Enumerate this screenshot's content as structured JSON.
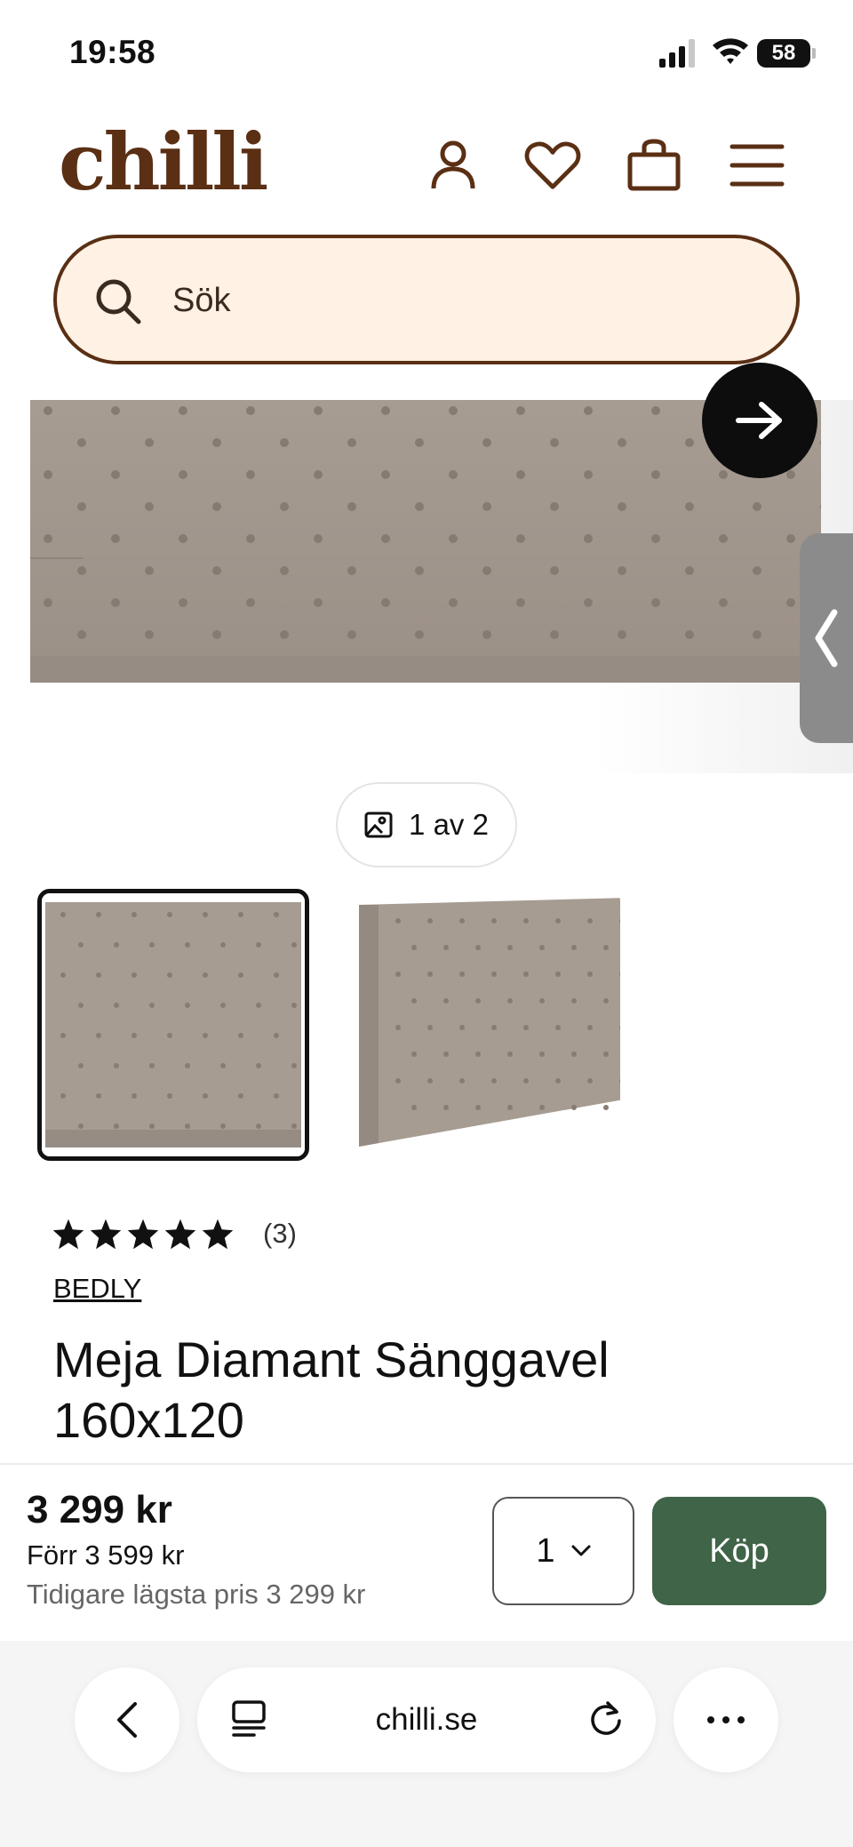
{
  "status_bar": {
    "time": "19:58",
    "battery": "58",
    "signal_bars": 3,
    "icons": [
      "signal-icon",
      "wifi-icon",
      "battery-icon"
    ]
  },
  "header": {
    "logo": "chilli",
    "brand_color": "#5a2f14",
    "icons": [
      "user-icon",
      "heart-icon",
      "bag-icon",
      "menu-icon"
    ]
  },
  "search": {
    "placeholder": "Sök",
    "background": "#fff1e4"
  },
  "gallery": {
    "counter": "1 av 2",
    "current_index": 1,
    "total": 2,
    "icons": [
      "image-icon",
      "arrow-right-icon",
      "chevron-left-icon"
    ]
  },
  "product": {
    "rating": 5,
    "review_count": "(3)",
    "brand": "BEDLY",
    "title": "Meja Diamant Sänggavel 160x120"
  },
  "buy_bar": {
    "price": "3 299 kr",
    "previous_price": "Förr 3 599 kr",
    "lowest_price": "Tidigare lägsta pris 3 299 kr",
    "quantity": "1",
    "buy_label": "Köp",
    "buy_color": "#3f6447"
  },
  "browser": {
    "url": "chilli.se",
    "icons": [
      "back-icon",
      "reader-icon",
      "reload-icon",
      "more-icon"
    ]
  }
}
